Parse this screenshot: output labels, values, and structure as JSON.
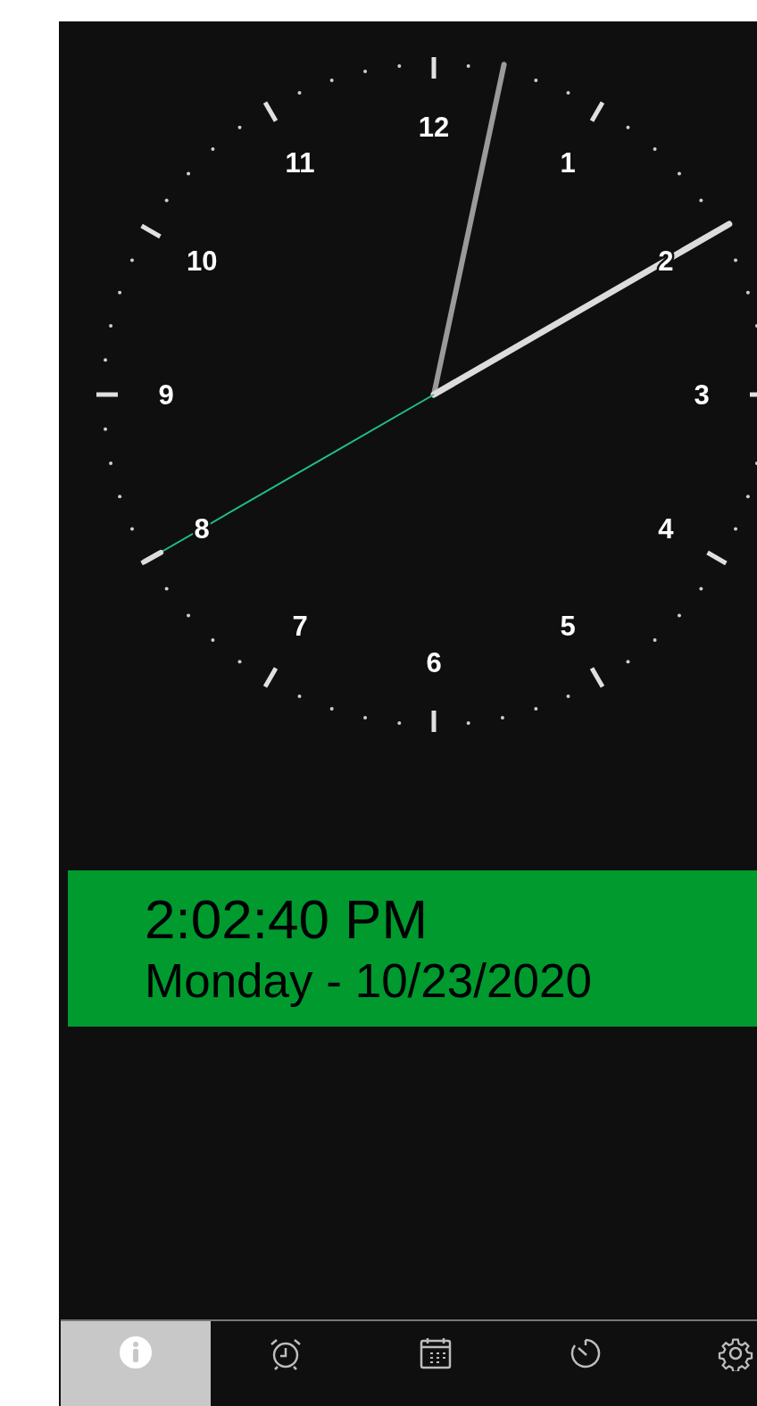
{
  "clock": {
    "numbers": [
      "12",
      "1",
      "2",
      "3",
      "4",
      "5",
      "6",
      "7",
      "8",
      "9",
      "10",
      "11"
    ]
  },
  "readout": {
    "time": "2:02:40 PM",
    "date": "Monday - 10/23/2020"
  },
  "tabs": [
    {
      "kind": "info",
      "selected": true
    },
    {
      "kind": "alarm",
      "selected": false
    },
    {
      "kind": "calendar",
      "selected": false
    },
    {
      "kind": "timer",
      "selected": false
    },
    {
      "kind": "settings",
      "selected": false
    }
  ]
}
